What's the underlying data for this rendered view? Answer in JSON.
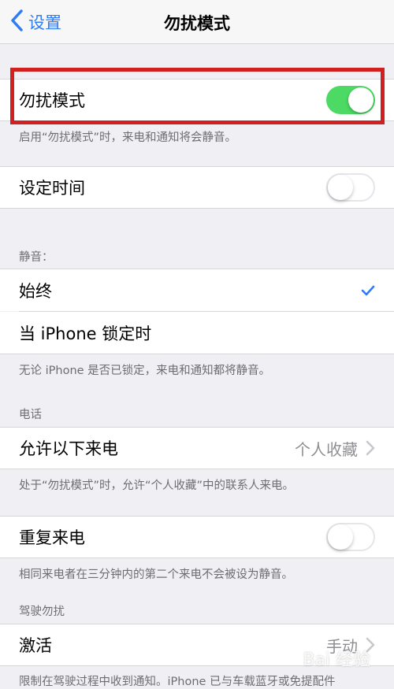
{
  "nav": {
    "back_label": "设置",
    "title": "勿扰模式"
  },
  "dnd": {
    "label": "勿扰模式",
    "enabled": true,
    "note": "启用“勿扰模式”时，来电和通知将会静音。"
  },
  "scheduled": {
    "label": "设定时间",
    "enabled": false
  },
  "silence": {
    "header": "静音：",
    "options": [
      {
        "label": "始终",
        "selected": true
      },
      {
        "label": "当 iPhone 锁定时",
        "selected": false
      }
    ],
    "note": "无论 iPhone 是否已锁定，来电和通知都将静音。"
  },
  "phone": {
    "header": "电话",
    "allow_calls_label": "允许以下来电",
    "allow_calls_value": "个人收藏",
    "note": "处于“勿扰模式”时，允许“个人收藏”中的联系人来电。"
  },
  "repeated": {
    "label": "重复来电",
    "enabled": false,
    "note": "相同来电者在三分钟内的第二个来电不会被设为静音。"
  },
  "driving": {
    "header": "驾驶勿扰",
    "activate_label": "激活",
    "activate_value": "手动",
    "note": "限制在驾驶过程中收到通知。iPhone 已与车载蓝牙或免提配件"
  },
  "watermark": "Bai 经验",
  "colors": {
    "accent": "#2f7cf6",
    "toggle_on": "#4cd964",
    "highlight": "#d0201f"
  }
}
